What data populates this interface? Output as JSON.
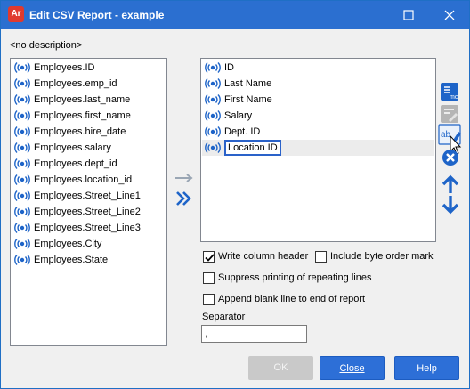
{
  "window": {
    "title": "Edit CSV Report - example",
    "app_icon_text": "Ar"
  },
  "description": "<no description>",
  "available_fields": [
    "Employees.ID",
    "Employees.emp_id",
    "Employees.last_name",
    "Employees.first_name",
    "Employees.hire_date",
    "Employees.salary",
    "Employees.dept_id",
    "Employees.location_id",
    "Employees.Street_Line1",
    "Employees.Street_Line2",
    "Employees.Street_Line3",
    "Employees.City",
    "Employees.State"
  ],
  "selected_fields": [
    "ID",
    "Last Name",
    "First Name",
    "Salary",
    "Dept. ID",
    "Location ID"
  ],
  "editing_field_index": 5,
  "options": {
    "write_column_header": {
      "label": "Write column header",
      "checked": true
    },
    "include_bom": {
      "label": "Include byte order mark",
      "checked": false
    },
    "suppress_repeating": {
      "label": "Suppress printing of repeating lines",
      "checked": false
    },
    "append_blank": {
      "label": "Append blank line to end of report",
      "checked": false
    }
  },
  "separator": {
    "label": "Separator",
    "value": ","
  },
  "buttons": {
    "ok": "OK",
    "close": "Close",
    "help": "Help"
  },
  "colors": {
    "accent": "#2d6fd7",
    "titlebar": "#2b6fd0",
    "icon_blue": "#1e64c8"
  },
  "icons": {
    "field": "signal-field-icon",
    "add": "arrow-right-icon",
    "add_all": "double-chevron-right-icon",
    "side": [
      "field-properties-icon",
      "edit-disabled-icon",
      "rename-icon",
      "remove-icon",
      "move-up-icon",
      "move-down-icon"
    ]
  }
}
